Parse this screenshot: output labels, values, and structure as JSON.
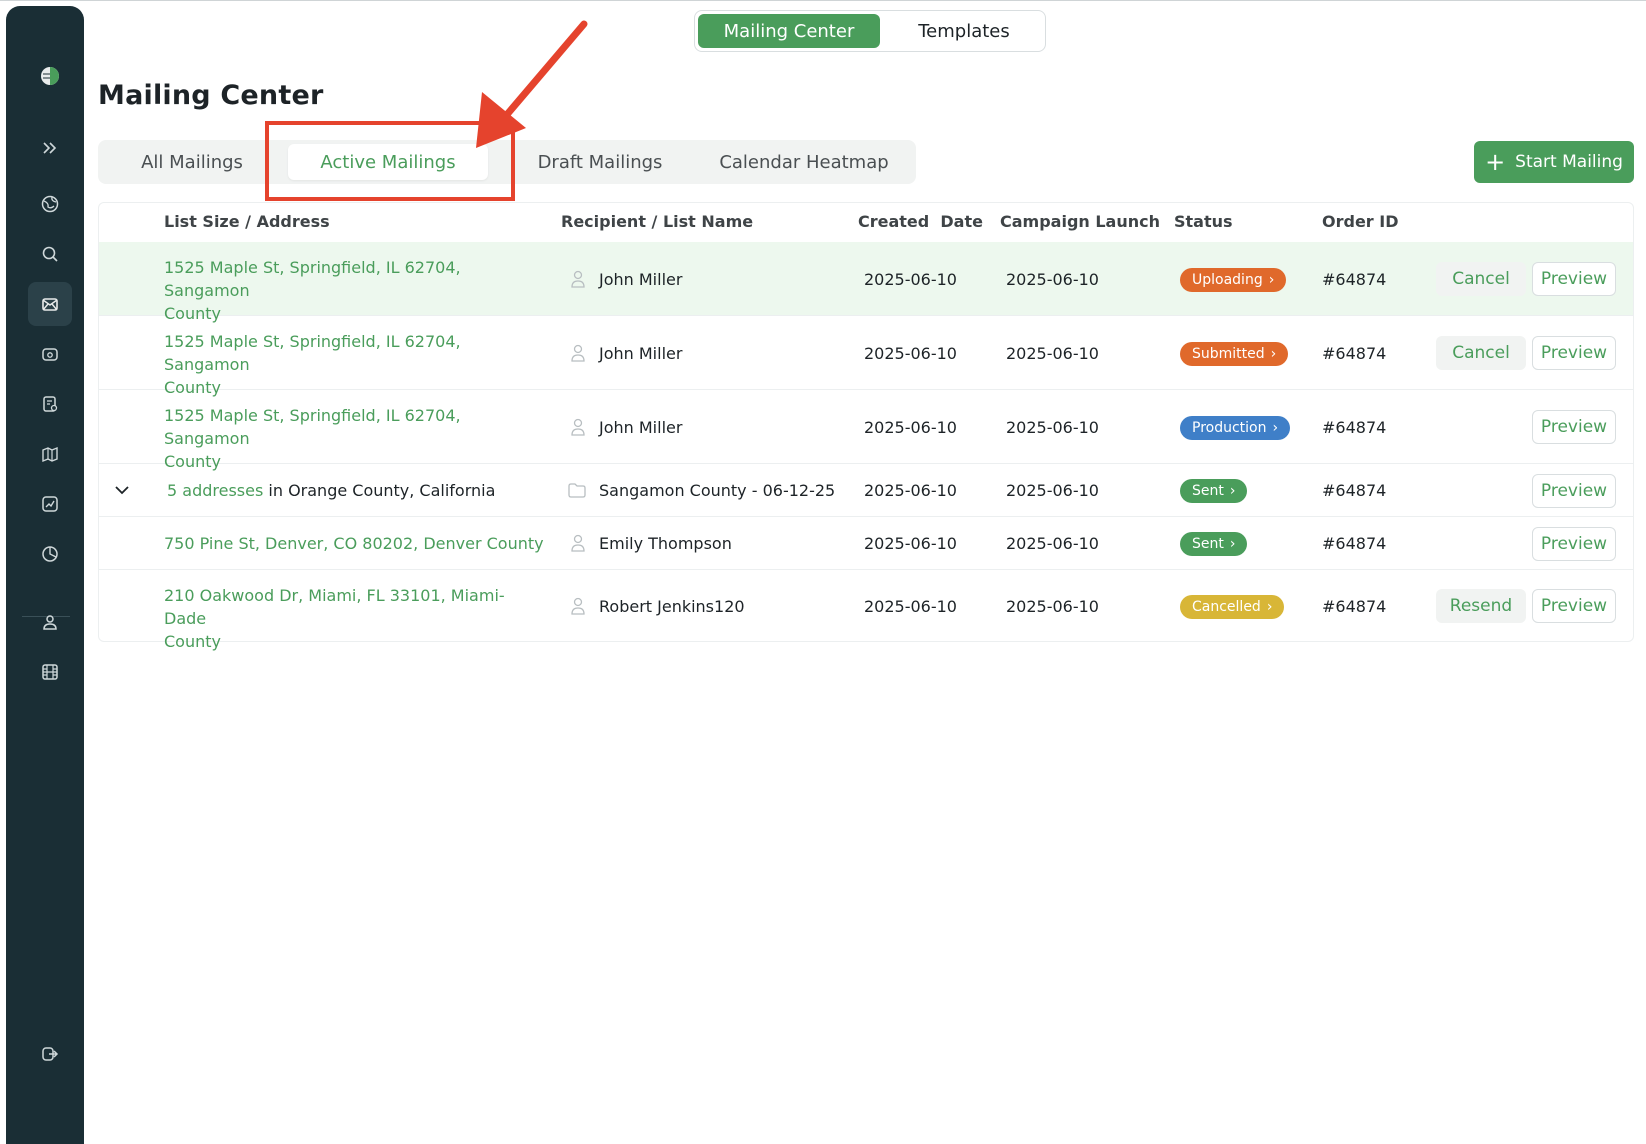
{
  "segment": {
    "active": "Mailing Center",
    "inactive": "Templates"
  },
  "page_title": "Mailing Center",
  "tabs": [
    {
      "label": "All Mailings"
    },
    {
      "label": "Active Mailings",
      "active": true
    },
    {
      "label": "Draft Mailings"
    },
    {
      "label": "Calendar Heatmap"
    }
  ],
  "start_button": {
    "label": "Start Mailing"
  },
  "table": {
    "headers": {
      "address": "List Size / Address",
      "recipient": "Recipient / List Name",
      "created": "Created  Date",
      "launch": "Campaign Launch",
      "status": "Status",
      "order": "Order ID"
    },
    "rows": [
      {
        "address_line1": "1525 Maple St, Springfield, IL 62704, Sangamon",
        "address_line2": "County",
        "recipient": "John Miller",
        "created": "2025-06-10",
        "launch": "2025-06-10",
        "status": "Uploading",
        "status_color": "#e0692b",
        "order": "#64874",
        "action": "Cancel",
        "preview": "Preview"
      },
      {
        "address_line1": "1525 Maple St, Springfield, IL 62704, Sangamon",
        "address_line2": "County",
        "recipient": "John Miller",
        "created": "2025-06-10",
        "launch": "2025-06-10",
        "status": "Submitted",
        "status_color": "#e0692b",
        "order": "#64874",
        "action": "Cancel",
        "preview": "Preview"
      },
      {
        "address_line1": "1525 Maple St, Springfield, IL 62704, Sangamon",
        "address_line2": "County",
        "recipient": "John Miller",
        "created": "2025-06-10",
        "launch": "2025-06-10",
        "status": "Production",
        "status_color": "#3f7fc8",
        "order": "#64874",
        "preview": "Preview"
      },
      {
        "address_link": "5 addresses",
        "address_rest": " in Orange County, California",
        "recipient": "Sangamon County - 06-12-25",
        "created": "2025-06-10",
        "launch": "2025-06-10",
        "status": "Sent",
        "status_color": "#4a9d5b",
        "order": "#64874",
        "preview": "Preview"
      },
      {
        "address_line1": "750 Pine St, Denver, CO 80202, Denver County",
        "recipient": "Emily Thompson",
        "created": "2025-06-10",
        "launch": "2025-06-10",
        "status": "Sent",
        "status_color": "#4a9d5b",
        "order": "#64874",
        "preview": "Preview"
      },
      {
        "address_line1": "210 Oakwood Dr, Miami, FL 33101, Miami-Dade",
        "address_line2": "County",
        "recipient": "Robert Jenkins120",
        "created": "2025-06-10",
        "launch": "2025-06-10",
        "status": "Cancelled",
        "status_color": "#d8b637",
        "order": "#64874",
        "action": "Resend",
        "preview": "Preview"
      }
    ]
  },
  "colors": {
    "brand": "#4a9d5b",
    "sidebar": "#1a2e35",
    "highlight": "#e5432d"
  },
  "sidebar_icons": [
    "logo-icon",
    "expand-icon",
    "globe-icon",
    "search-icon",
    "mail-icon",
    "folder-icon",
    "document-icon",
    "map-icon",
    "chart-icon",
    "pie-chart-icon",
    "user-icon",
    "film-icon",
    "logout-icon"
  ]
}
